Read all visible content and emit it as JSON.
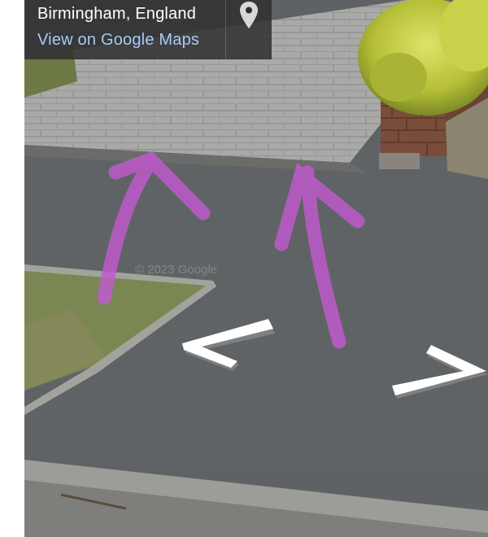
{
  "location": {
    "place_name": "Birmingham, England",
    "maps_link_label": "View on Google Maps",
    "pin_icon": "map-pin-icon"
  },
  "imagery": {
    "watermark": "© 2023 Google"
  },
  "navigation": {
    "left_arrow_icon": "nav-arrow-left-icon",
    "right_arrow_icon": "nav-arrow-right-icon"
  },
  "annotations": {
    "count": 2,
    "color": "#c25ad0",
    "icon": "up-arrow-marker-icon"
  },
  "colors": {
    "road": "#5f6265",
    "paving": "#a9aaa8",
    "grass": "#7d8a52",
    "hedge": "#b9c43c",
    "brick": "#7a4d3a",
    "link": "#a9c8f5"
  }
}
